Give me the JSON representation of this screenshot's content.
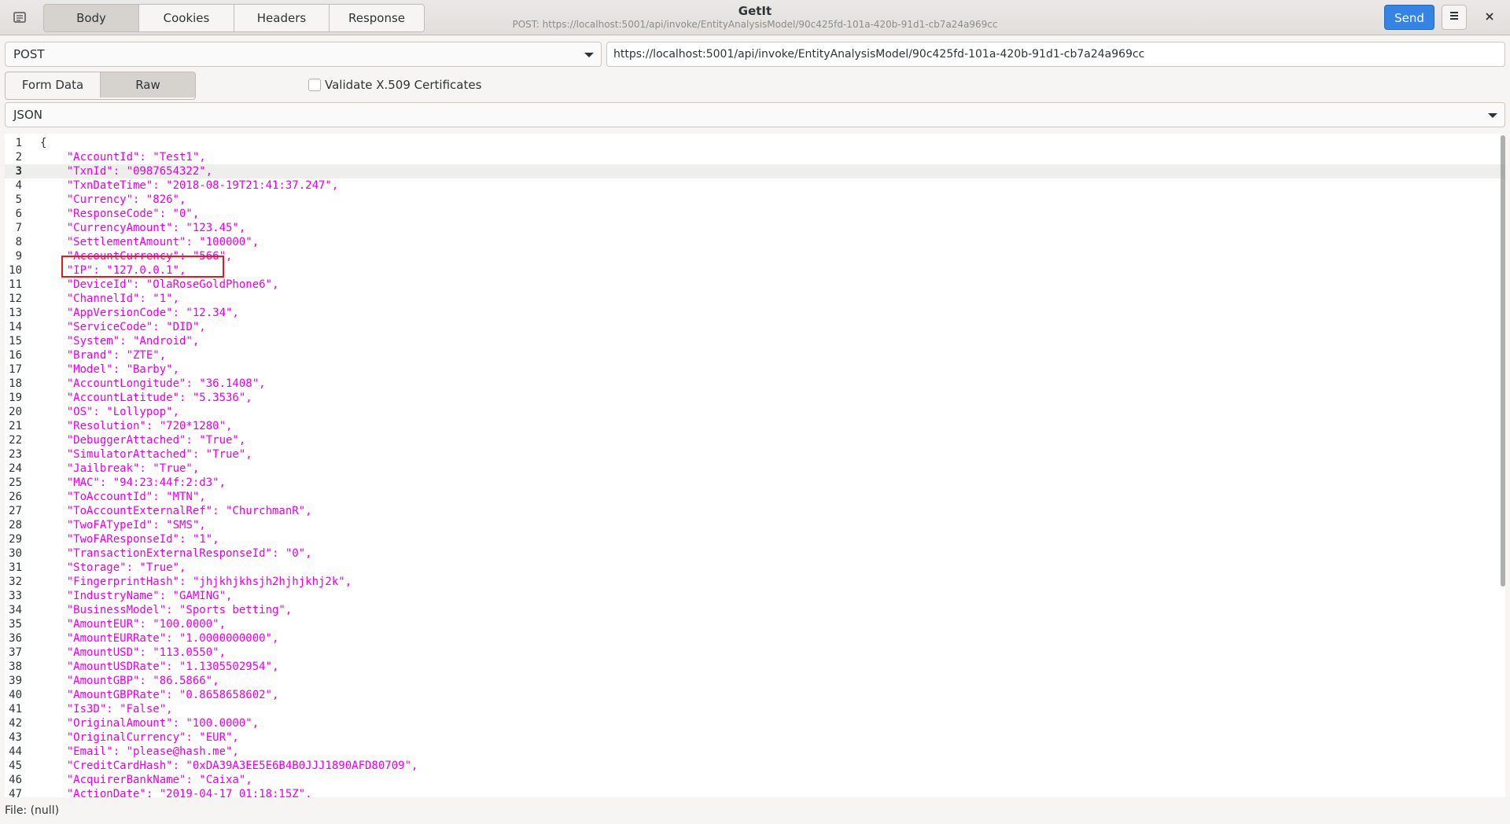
{
  "header": {
    "tabs": [
      {
        "label": "Body",
        "active": true
      },
      {
        "label": "Cookies",
        "active": false
      },
      {
        "label": "Headers",
        "active": false
      },
      {
        "label": "Response",
        "active": false
      }
    ],
    "title": "GetIt",
    "subtitle": "POST: https://localhost:5001/api/invoke/EntityAnalysisModel/90c425fd-101a-420b-91d1-cb7a24a969cc",
    "send_label": "Send",
    "menu_icon": "hamburger-menu-icon",
    "close_icon": "close-icon"
  },
  "request": {
    "method": "POST",
    "url": "https://localhost:5001/api/invoke/EntityAnalysisModel/90c425fd-101a-420b-91d1-cb7a24a969cc"
  },
  "body_mode": {
    "tabs": [
      {
        "label": "Form Data",
        "active": false
      },
      {
        "label": "Raw",
        "active": true
      }
    ],
    "validate_label": "Validate X.509 Certificates",
    "validate_checked": false
  },
  "format": "JSON",
  "editor": {
    "current_line": 3,
    "lines": [
      "{",
      "    \"AccountId\": \"Test1\",",
      "    \"TxnId\": \"0987654322\",",
      "    \"TxnDateTime\": \"2018-08-19T21:41:37.247\",",
      "    \"Currency\": \"826\",",
      "    \"ResponseCode\": \"0\",",
      "    \"CurrencyAmount\": \"123.45\",",
      "    \"SettlementAmount\": \"100000\",",
      "    \"AccountCurrency\": \"566\",",
      "    \"IP\": \"127.0.0.1\",",
      "    \"DeviceId\": \"OlaRoseGoldPhone6\",",
      "    \"ChannelId\": \"1\",",
      "    \"AppVersionCode\": \"12.34\",",
      "    \"ServiceCode\": \"DID\",",
      "    \"System\": \"Android\",",
      "    \"Brand\": \"ZTE\",",
      "    \"Model\": \"Barby\",",
      "    \"AccountLongitude\": \"36.1408\",",
      "    \"AccountLatitude\": \"5.3536\",",
      "    \"OS\": \"Lollypop\",",
      "    \"Resolution\": \"720*1280\",",
      "    \"DebuggerAttached\": \"True\",",
      "    \"SimulatorAttached\": \"True\",",
      "    \"Jailbreak\": \"True\",",
      "    \"MAC\": \"94:23:44f:2:d3\",",
      "    \"ToAccountId\": \"MTN\",",
      "    \"ToAccountExternalRef\": \"ChurchmanR\",",
      "    \"TwoFATypeId\": \"SMS\",",
      "    \"TwoFAResponseId\": \"1\",",
      "    \"TransactionExternalResponseId\": \"0\",",
      "    \"Storage\": \"True\",",
      "    \"FingerprintHash\": \"jhjkhjkhsjh2hjhjkhj2k\",",
      "    \"IndustryName\": \"GAMING\",",
      "    \"BusinessModel\": \"Sports betting\",",
      "    \"AmountEUR\": \"100.0000\",",
      "    \"AmountEURRate\": \"1.0000000000\",",
      "    \"AmountUSD\": \"113.0550\",",
      "    \"AmountUSDRate\": \"1.1305502954\",",
      "    \"AmountGBP\": \"86.5866\",",
      "    \"AmountGBPRate\": \"0.8658658602\",",
      "    \"Is3D\": \"False\",",
      "    \"OriginalAmount\": \"100.0000\",",
      "    \"OriginalCurrency\": \"EUR\",",
      "    \"Email\": \"please@hash.me\",",
      "    \"CreditCardHash\": \"0xDA39A3EE5E6B4B0JJJ1890AFD80709\",",
      "    \"AcquirerBankName\": \"Caixa\",",
      "    \"ActionDate\": \"2019-04-17 01:18:15Z\","
    ]
  },
  "status": "File: (null)",
  "colors": {
    "accent": "#3584e4",
    "json_string": "#e600e6",
    "highlight_box": "#e01b24"
  }
}
